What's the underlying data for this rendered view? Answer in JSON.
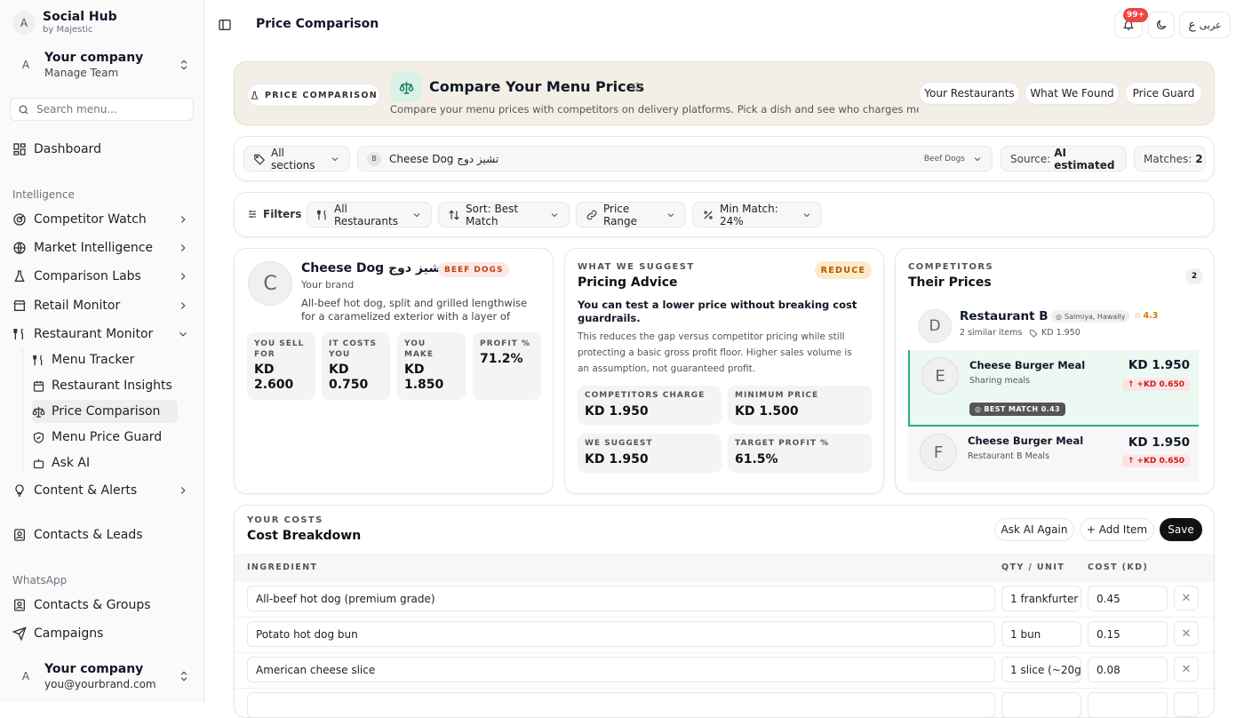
{
  "app": {
    "name": "Social Hub",
    "byline": "by Majestic",
    "avatar": "A"
  },
  "org": {
    "name": "Your company",
    "sub": "Manage Team",
    "avatar": "A"
  },
  "search": {
    "placeholder": "Search menu..."
  },
  "nav": {
    "dashboard": "Dashboard",
    "section_intel": "Intelligence",
    "competitor_watch": "Competitor Watch",
    "market_intel": "Market Intelligence",
    "comparison_labs": "Comparison Labs",
    "retail_monitor": "Retail Monitor",
    "restaurant_monitor": "Restaurant Monitor",
    "menu_tracker": "Menu Tracker",
    "restaurant_insights": "Restaurant Insights",
    "price_comparison": "Price Comparison",
    "menu_price_guard": "Menu Price Guard",
    "ask_ai": "Ask AI",
    "content_alerts": "Content & Alerts",
    "contacts_leads": "Contacts & Leads",
    "section_whatsapp": "WhatsApp",
    "contacts_groups": "Contacts & Groups",
    "campaigns": "Campaigns"
  },
  "user": {
    "name": "Your company",
    "email": "you@yourbrand.com",
    "avatar": "A"
  },
  "header": {
    "title": "Price Comparison",
    "notif_badge": "99+",
    "lang": "عربى"
  },
  "hero": {
    "tag": "PRICE COMPARISON",
    "title": "Compare Your Menu Prices",
    "subtitle": "Compare your menu prices with competitors on delivery platforms. Pick a dish and see who charges more...",
    "tabs": [
      "Your Restaurants",
      "What We Found",
      "Price Guard"
    ]
  },
  "selector": {
    "sections": "All sections",
    "dish_avatar": "B",
    "dish": "Cheese Dog تشيز دوج",
    "dish_category": "Beef Dogs",
    "source_label": "Source:",
    "source_value": "AI estimated",
    "matches_label": "Matches:",
    "matches_value": "2"
  },
  "filters": {
    "label": "Filters",
    "restaurants": "All Restaurants",
    "sort": "Sort: Best Match",
    "price_range": "Price Range",
    "min_match": "Min Match: 24%"
  },
  "dish": {
    "avatar": "C",
    "name": "Cheese Dog تشيز دوج",
    "badge": "BEEF DOGS",
    "brand": "Your brand",
    "desc": "All-beef hot dog, split and grilled lengthwise for a caramelized exterior with a layer of American-...",
    "stats": [
      {
        "label": "YOU SELL FOR",
        "value": "KD 2.600"
      },
      {
        "label": "IT COSTS YOU",
        "value": "KD 0.750"
      },
      {
        "label": "YOU MAKE",
        "value": "KD 1.850"
      },
      {
        "label": "PROFIT %",
        "value": "71.2%"
      }
    ]
  },
  "advice": {
    "kicker": "WHAT WE SUGGEST",
    "title": "Pricing Advice",
    "badge": "REDUCE",
    "headline": "You can test a lower price without breaking cost guardrails.",
    "body": "This reduces the gap versus competitor pricing while still protecting a basic gross profit floor. Higher sales volume is an assumption, not guaranteed profit.",
    "boxes": [
      {
        "label": "COMPETITORS CHARGE",
        "value": "KD 1.950"
      },
      {
        "label": "MINIMUM PRICE",
        "value": "KD 1.500"
      },
      {
        "label": "WE SUGGEST",
        "value": "KD 1.950"
      },
      {
        "label": "TARGET PROFIT %",
        "value": "61.5%"
      }
    ]
  },
  "competitors": {
    "kicker": "COMPETITORS",
    "title": "Their Prices",
    "count": "2",
    "restaurant": {
      "avatar": "D",
      "name": "Restaurant B",
      "location": "Salmiya, Hawally",
      "rating": "4.3",
      "similar": "2 similar items",
      "price": "KD 1.950"
    },
    "items": [
      {
        "avatar": "E",
        "name": "Cheese Burger Meal",
        "category": "Sharing meals",
        "price": "KD 1.950",
        "delta": "+KD 0.650",
        "match": "BEST MATCH 0.43"
      },
      {
        "avatar": "F",
        "name": "Cheese Burger Meal",
        "category": "Restaurant B Meals",
        "price": "KD 1.950",
        "delta": "+KD 0.650"
      }
    ]
  },
  "costs": {
    "kicker": "YOUR COSTS",
    "title": "Cost Breakdown",
    "ask_ai": "Ask AI Again",
    "add_item": "+ Add Item",
    "save": "Save",
    "col_ingredient": "INGREDIENT",
    "col_qty": "QTY / UNIT",
    "col_cost": "COST (KD)",
    "rows": [
      {
        "ingredient": "All-beef hot dog (premium grade)",
        "qty": "1 frankfurter",
        "cost": "0.45"
      },
      {
        "ingredient": "Potato hot dog bun",
        "qty": "1 bun",
        "cost": "0.15"
      },
      {
        "ingredient": "American cheese slice",
        "qty": "1 slice (~20g",
        "cost": "0.08"
      }
    ]
  }
}
